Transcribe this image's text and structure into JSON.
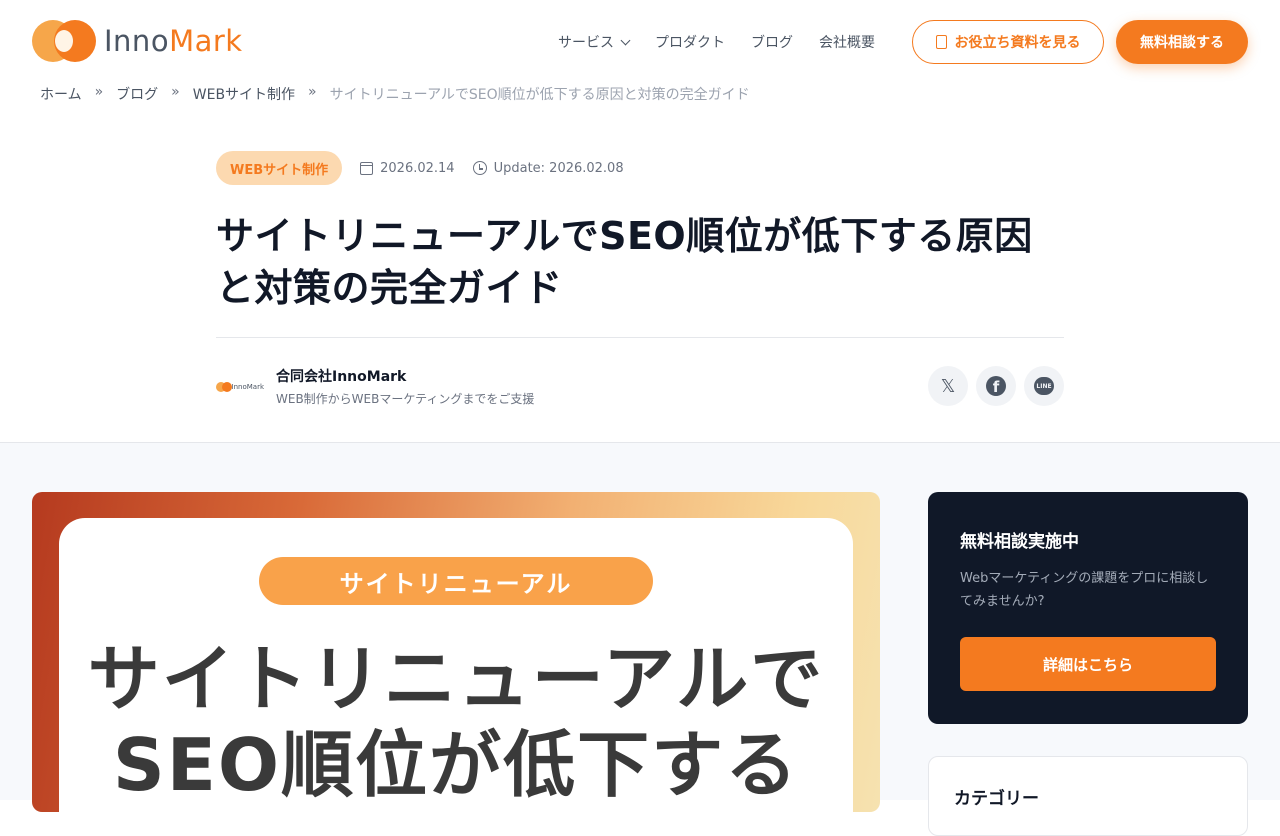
{
  "header": {
    "logo": {
      "part1": "Inno",
      "part2": "Mark"
    },
    "nav": [
      {
        "label": "サービス"
      },
      {
        "label": "プロダクト"
      },
      {
        "label": "ブログ"
      },
      {
        "label": "会社概要"
      }
    ],
    "doc_button": "お役立ち資料を見る",
    "consult_button": "無料相談する"
  },
  "breadcrumb": {
    "items": [
      "ホーム",
      "ブログ",
      "WEBサイト制作"
    ],
    "separator": "»",
    "current": "サイトリニューアルでSEO順位が低下する原因と対策の完全ガイド"
  },
  "article": {
    "category": "WEBサイト制作",
    "published": "2026.02.14",
    "updated": "Update: 2026.02.08",
    "title": "サイトリニューアルでSEO順位が低下する原因と対策の完全ガイド",
    "author": {
      "name": "合同会社InnoMark",
      "description": "WEB制作からWEBマーケティングまでをご支援",
      "logo_text": "InnoMark"
    },
    "share": [
      {
        "icon": "x-icon",
        "glyph": "𝕏"
      },
      {
        "icon": "facebook-icon",
        "glyph": "f"
      },
      {
        "icon": "line-icon",
        "glyph": "LINE"
      }
    ]
  },
  "hero": {
    "pill": "サイトリニューアル",
    "title_line1": "サイトリニューアルで",
    "title_line2": "SEO順位が低下する"
  },
  "sidebar": {
    "cta": {
      "title": "無料相談実施中",
      "text": "Webマーケティングの課題をプロに相談してみませんか?",
      "button": "詳細はこちら"
    },
    "categories": {
      "title": "カテゴリー"
    }
  },
  "colors": {
    "accent": "#f47a1f",
    "dark": "#101828",
    "badge_bg": "#fcd9b0"
  }
}
